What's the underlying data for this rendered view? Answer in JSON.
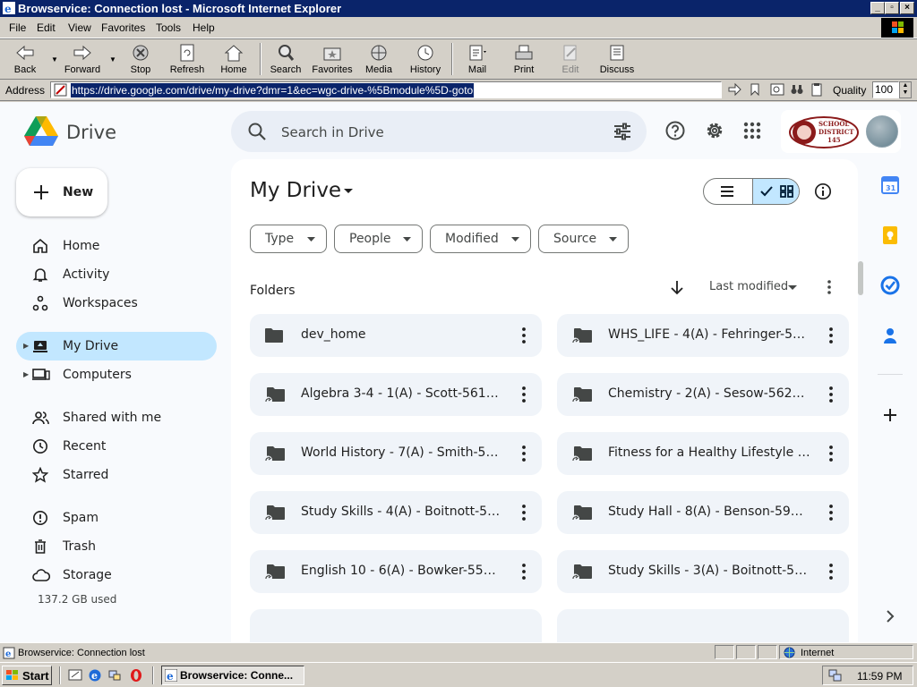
{
  "window": {
    "title": "Browservice: Connection lost - Microsoft Internet Explorer"
  },
  "menu": [
    "File",
    "Edit",
    "View",
    "Favorites",
    "Tools",
    "Help"
  ],
  "toolbar": {
    "back": "Back",
    "forward": "Forward",
    "stop": "Stop",
    "refresh": "Refresh",
    "home": "Home",
    "search": "Search",
    "favorites": "Favorites",
    "media": "Media",
    "history": "History",
    "mail": "Mail",
    "print": "Print",
    "edit": "Edit",
    "discuss": "Discuss"
  },
  "address": {
    "label": "Address",
    "url": "https://drive.google.com/drive/my-drive?dmr=1&ec=wgc-drive-%5Bmodule%5D-goto",
    "quality_label": "Quality",
    "quality_value": "100"
  },
  "drive": {
    "app_name": "Drive",
    "search_placeholder": "Search in Drive",
    "school_logo": "SCHOOL DISTRICT 145",
    "new_label": "New",
    "nav": {
      "home": "Home",
      "activity": "Activity",
      "workspaces": "Workspaces",
      "my_drive": "My Drive",
      "computers": "Computers",
      "shared": "Shared with me",
      "recent": "Recent",
      "starred": "Starred",
      "spam": "Spam",
      "trash": "Trash",
      "storage": "Storage"
    },
    "storage_used": "137.2 GB used",
    "page_title": "My Drive",
    "filters": {
      "type": "Type",
      "people": "People",
      "modified": "Modified",
      "source": "Source"
    },
    "folders_label": "Folders",
    "sort_label": "Last modified",
    "folders": [
      "dev_home",
      "WHS_LIFE - 4(A) - Fehringer-55...",
      "Algebra 3-4 - 1(A) - Scott-56141...",
      "Chemistry - 2(A) - Sesow-5626...",
      "World History - 7(A) - Smith-56...",
      "Fitness for a Healthy Lifestyle -...",
      "Study Skills - 4(A) - Boitnott-56...",
      "Study Hall - 8(A) - Benson-592...",
      "English 10 - 6(A) - Bowker-5592...",
      "Study Skills - 3(A) - Boitnott-56..."
    ]
  },
  "status": {
    "text": "Browservice: Connection lost",
    "zone": "Internet"
  },
  "taskbar": {
    "start": "Start",
    "task": "Browservice: Conne...",
    "clock": "11:59 PM"
  },
  "colors": {
    "titlebar": "#0a246a",
    "drive_active": "#c2e7ff",
    "drive_bg": "#f8fafd",
    "folder_bg": "#f0f4f9"
  }
}
